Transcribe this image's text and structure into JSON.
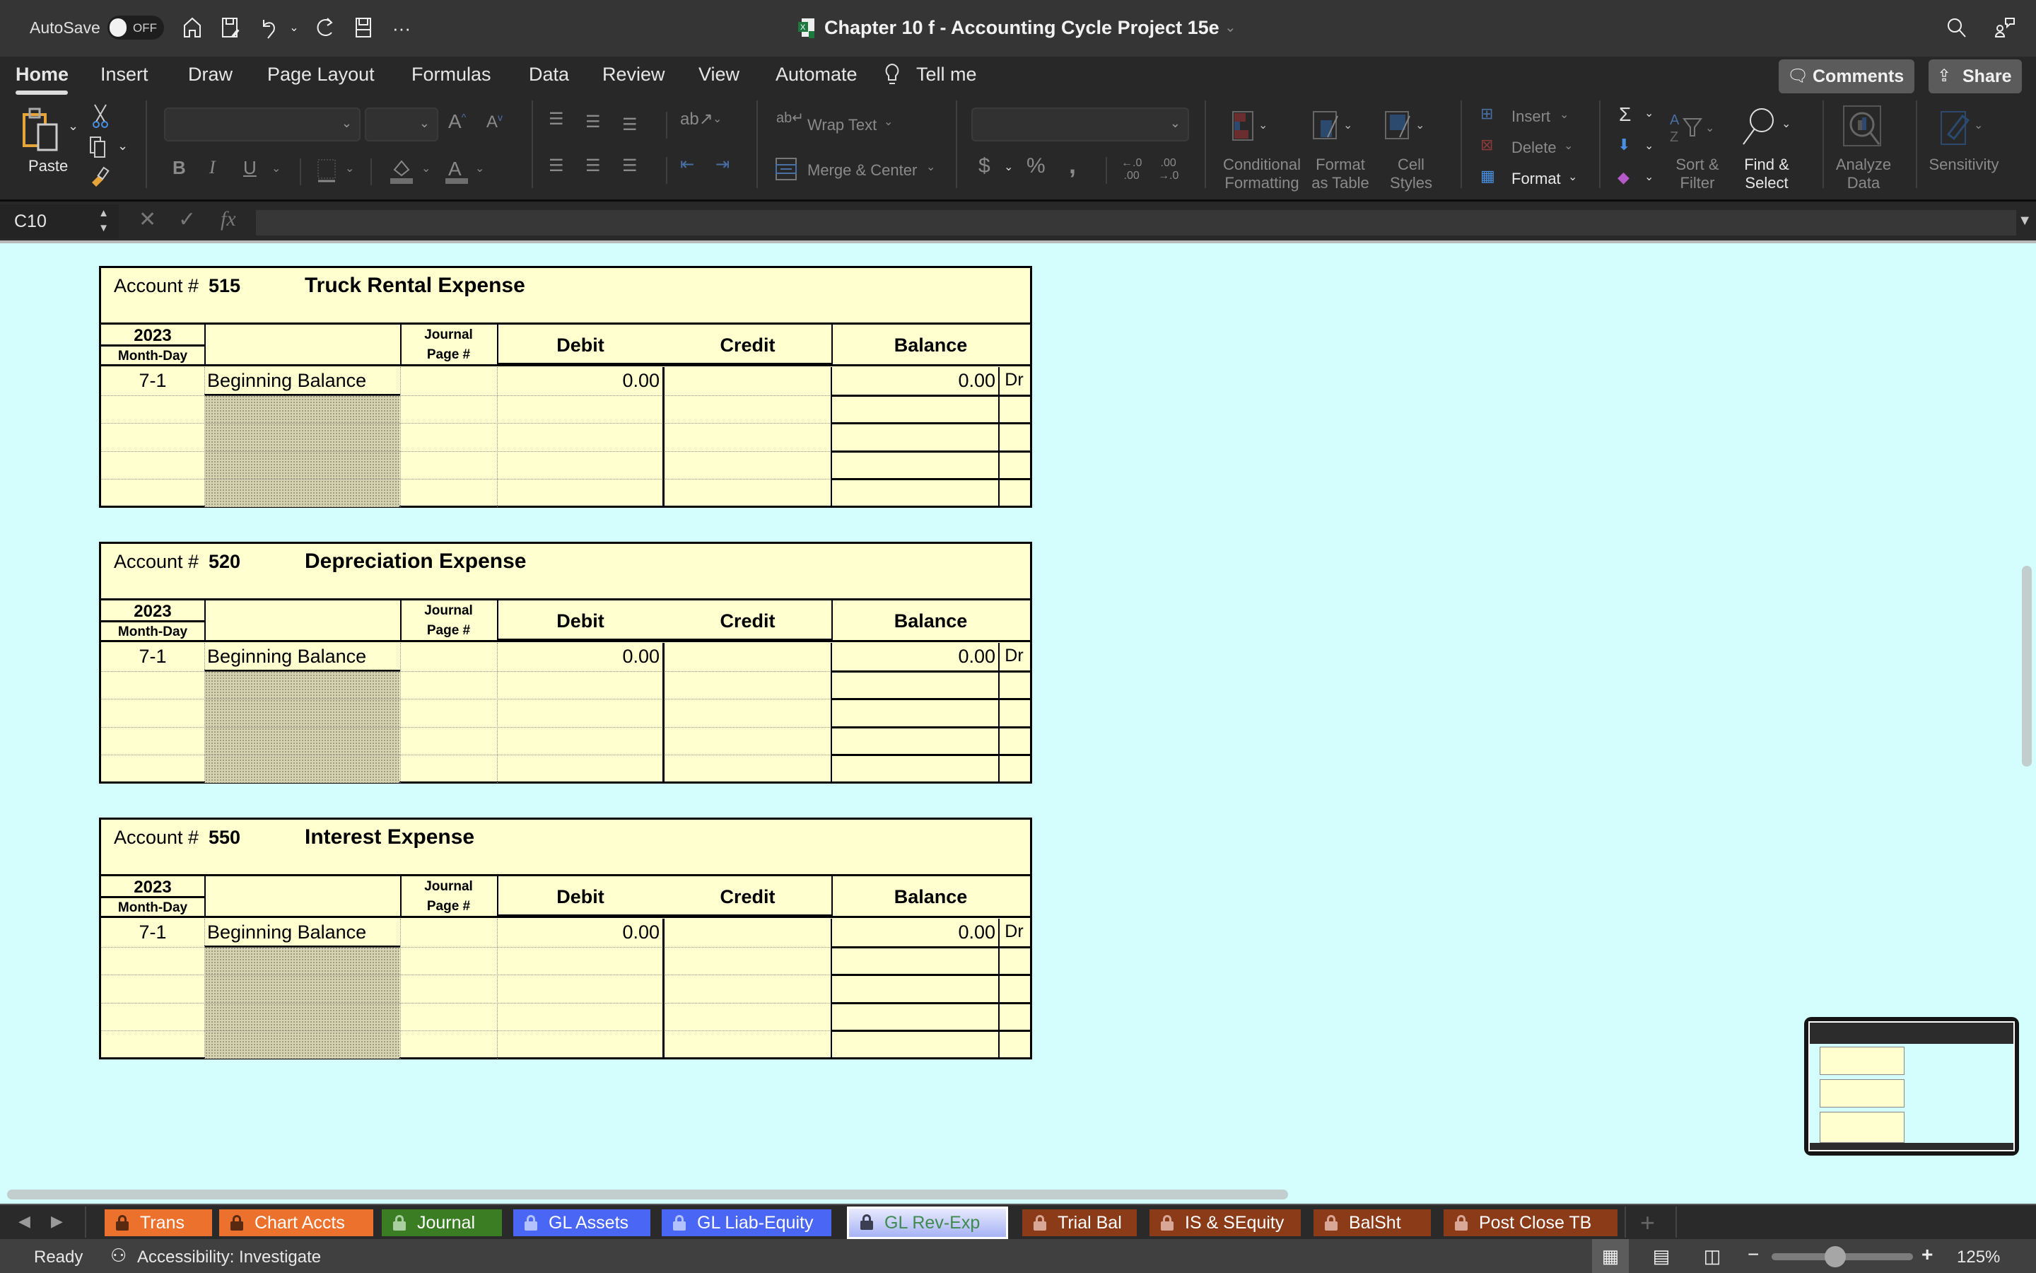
{
  "titlebar": {
    "autosave_label": "AutoSave",
    "autosave_state": "OFF",
    "document_title": "Chapter 10 f - Accounting Cycle Project 15e",
    "quick_access_icons": [
      "home-icon",
      "save-as-icon",
      "undo-icon",
      "redo-icon",
      "save-icon",
      "more-icon"
    ]
  },
  "menu": {
    "tabs": [
      "Home",
      "Insert",
      "Draw",
      "Page Layout",
      "Formulas",
      "Data",
      "Review",
      "View",
      "Automate",
      "Tell me"
    ],
    "active_tab": "Home",
    "comments_label": "Comments",
    "share_label": "Share"
  },
  "ribbon": {
    "paste_label": "Paste",
    "wrap_text_label": "Wrap Text",
    "merge_center_label": "Merge & Center",
    "font_name_value": "",
    "font_size_value": "",
    "number_format_value": "",
    "conditional_formatting_label": "Conditional Formatting",
    "conditional_line1": "Conditional",
    "conditional_line2": "Formatting",
    "format_table_line1": "Format",
    "format_table_line2": "as Table",
    "cell_styles_line1": "Cell",
    "cell_styles_line2": "Styles",
    "insert_label": "Insert",
    "delete_label": "Delete",
    "format_label": "Format",
    "sort_line1": "Sort &",
    "sort_line2": "Filter",
    "find_line1": "Find &",
    "find_line2": "Select",
    "analyze_line1": "Analyze",
    "analyze_line2": "Data",
    "sensitivity_label": "Sensitivity",
    "bold": "B",
    "italic": "I",
    "underline": "U",
    "currency": "$",
    "percent": "%",
    "comma": ","
  },
  "formula_bar": {
    "name_box": "C10",
    "formula_value": "",
    "fx_label": "fx"
  },
  "ledgers": [
    {
      "account_label": "Account #",
      "account_number": "515",
      "account_name": "Truck Rental Expense",
      "year": "2023",
      "month_day_label": "Month-Day",
      "journal_line1": "Journal",
      "journal_line2": "Page #",
      "debit_label": "Debit",
      "credit_label": "Credit",
      "balance_label": "Balance",
      "rows": [
        {
          "date": "7-1",
          "description": "Beginning Balance",
          "journal": "",
          "debit": "0.00",
          "credit": "",
          "balance": "0.00",
          "drcr": "Dr"
        },
        {
          "date": "",
          "description": "",
          "journal": "",
          "debit": "",
          "credit": "",
          "balance": "",
          "drcr": ""
        },
        {
          "date": "",
          "description": "",
          "journal": "",
          "debit": "",
          "credit": "",
          "balance": "",
          "drcr": ""
        },
        {
          "date": "",
          "description": "",
          "journal": "",
          "debit": "",
          "credit": "",
          "balance": "",
          "drcr": ""
        },
        {
          "date": "",
          "description": "",
          "journal": "",
          "debit": "",
          "credit": "",
          "balance": "",
          "drcr": ""
        }
      ]
    },
    {
      "account_label": "Account #",
      "account_number": "520",
      "account_name": "Depreciation Expense",
      "year": "2023",
      "month_day_label": "Month-Day",
      "journal_line1": "Journal",
      "journal_line2": "Page #",
      "debit_label": "Debit",
      "credit_label": "Credit",
      "balance_label": "Balance",
      "rows": [
        {
          "date": "7-1",
          "description": "Beginning Balance",
          "journal": "",
          "debit": "0.00",
          "credit": "",
          "balance": "0.00",
          "drcr": "Dr"
        },
        {
          "date": "",
          "description": "",
          "journal": "",
          "debit": "",
          "credit": "",
          "balance": "",
          "drcr": ""
        },
        {
          "date": "",
          "description": "",
          "journal": "",
          "debit": "",
          "credit": "",
          "balance": "",
          "drcr": ""
        },
        {
          "date": "",
          "description": "",
          "journal": "",
          "debit": "",
          "credit": "",
          "balance": "",
          "drcr": ""
        },
        {
          "date": "",
          "description": "",
          "journal": "",
          "debit": "",
          "credit": "",
          "balance": "",
          "drcr": ""
        }
      ]
    },
    {
      "account_label": "Account #",
      "account_number": "550",
      "account_name": "Interest Expense",
      "year": "2023",
      "month_day_label": "Month-Day",
      "journal_line1": "Journal",
      "journal_line2": "Page #",
      "debit_label": "Debit",
      "credit_label": "Credit",
      "balance_label": "Balance",
      "rows": [
        {
          "date": "7-1",
          "description": "Beginning Balance",
          "journal": "",
          "debit": "0.00",
          "credit": "",
          "balance": "0.00",
          "drcr": "Dr"
        },
        {
          "date": "",
          "description": "",
          "journal": "",
          "debit": "",
          "credit": "",
          "balance": "",
          "drcr": ""
        },
        {
          "date": "",
          "description": "",
          "journal": "",
          "debit": "",
          "credit": "",
          "balance": "",
          "drcr": ""
        },
        {
          "date": "",
          "description": "",
          "journal": "",
          "debit": "",
          "credit": "",
          "balance": "",
          "drcr": ""
        },
        {
          "date": "",
          "description": "",
          "journal": "",
          "debit": "",
          "credit": "",
          "balance": "",
          "drcr": ""
        }
      ]
    }
  ],
  "sheet_tabs": [
    {
      "label": "Trans",
      "color": "#ec712c",
      "lock_color": "#5a2a10",
      "active": false
    },
    {
      "label": "Chart Accts",
      "color": "#ec712c",
      "lock_color": "#5a2a10",
      "active": false
    },
    {
      "label": "Journal",
      "color": "#3a7d22",
      "lock_color": "#a9cfa0",
      "active": false
    },
    {
      "label": "GL Assets",
      "color": "#4a66f5",
      "lock_color": "#b4c2fb",
      "active": false
    },
    {
      "label": "GL Liab-Equity",
      "color": "#4a66f5",
      "lock_color": "#b4c2fb",
      "active": false
    },
    {
      "label": "GL Rev-Exp",
      "color": "#a6b3f5",
      "lock_color": "#3c3f52",
      "active": true
    },
    {
      "label": "Trial Bal",
      "color": "#8b3b18",
      "lock_color": "#d9a796",
      "active": false
    },
    {
      "label": "IS & SEquity",
      "color": "#8b3b18",
      "lock_color": "#d9a796",
      "active": false
    },
    {
      "label": "BalSht",
      "color": "#8b3b18",
      "lock_color": "#d9a796",
      "active": false
    },
    {
      "label": "Post Close TB",
      "color": "#8b3b18",
      "lock_color": "#d9a796",
      "active": false
    }
  ],
  "status_bar": {
    "mode": "Ready",
    "accessibility": "Accessibility: Investigate",
    "zoom_level": "125%",
    "zoom_fraction": 0.45
  },
  "colors": {
    "sheet_background": "#d4fefe",
    "ledger_fill": "#ffffd0"
  }
}
